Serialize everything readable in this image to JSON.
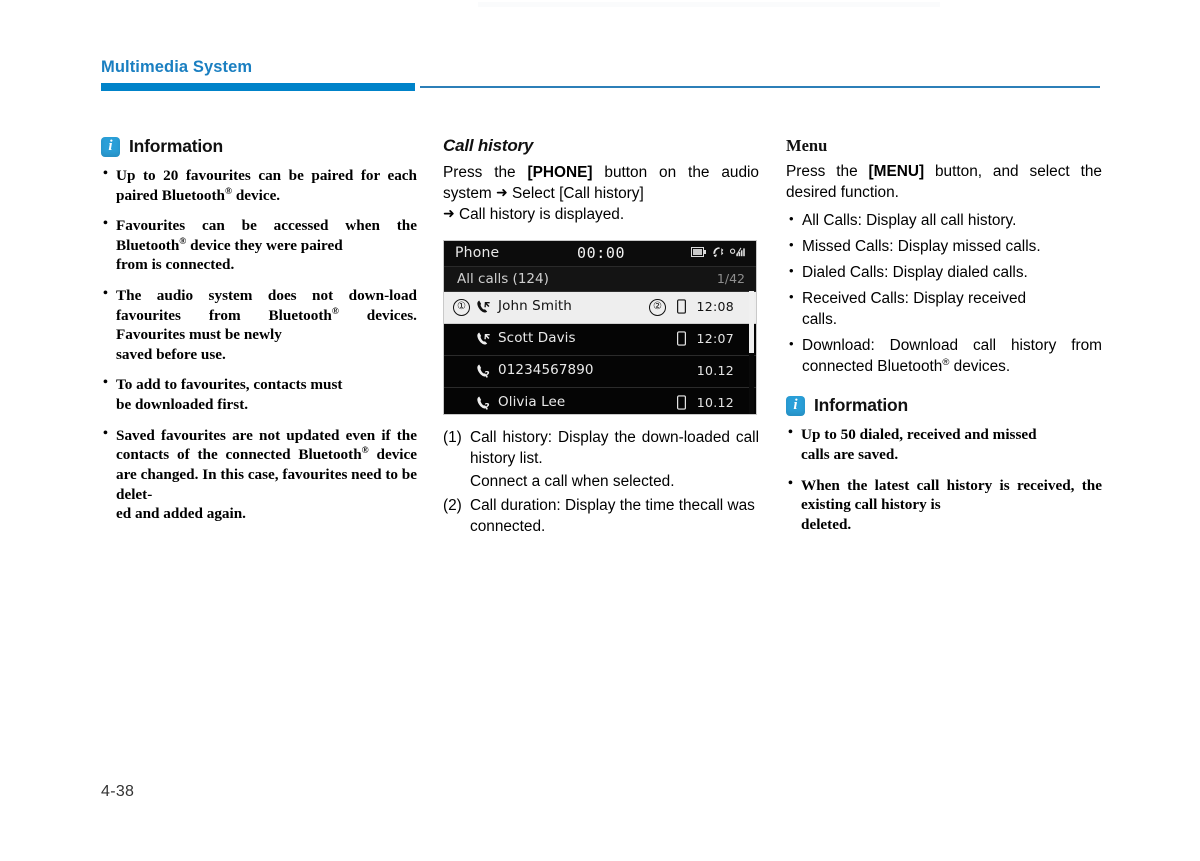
{
  "header": {
    "title": "Multimedia System",
    "accent_color": "#0083c9",
    "rule_color": "#2c7fb8"
  },
  "footer": {
    "page_number": "4-38"
  },
  "left_column": {
    "info": {
      "icon": "info-i-icon",
      "badge_color": "#2a9fd8",
      "title": "Information",
      "bullets": [
        {
          "text": "Up to 20 favourites can be paired for each paired Bluetooth",
          "reg": "®",
          "tail": " device."
        },
        {
          "text": "Favourites can be accessed when the Bluetooth",
          "reg": "®",
          "tail": " device they were paired",
          "lastline": "from is connected."
        },
        {
          "text": "The audio system does not down-load favourites from Bluetooth",
          "reg": "®",
          "tail": " devices. Favourites  must be newly",
          "lastline": "saved before use."
        },
        {
          "text": "To add to favourites, contacts must",
          "lastline": "be downloaded first."
        },
        {
          "text": "Saved favourites are not updated even if the contacts of the connected Bluetooth",
          "reg": "®",
          "tail": " device are changed. In this case, favourites need to be delet-",
          "lastline": "ed and added again."
        }
      ]
    }
  },
  "mid_column": {
    "section_title": "Call history",
    "intro": {
      "p1_a": "Press the ",
      "p1_b": "[PHONE]",
      "p1_c": " button on the audio system ",
      "arrow1": "➜",
      "p1_d": " Select [Call history]",
      "p2_arrow": "➜",
      "p2": " Call history is displayed."
    },
    "device": {
      "status_bar": {
        "title": "Phone",
        "clock": "00:00",
        "icons": [
          "battery-icon",
          "bluetooth-phone-icon",
          "signal-roaming-icon"
        ]
      },
      "sub_bar": {
        "label": "All calls (124)",
        "page": "1/42"
      },
      "rows": [
        {
          "callout": "①",
          "call_icon": "call-received-icon",
          "name": "John Smith",
          "callout2": "②",
          "device_icon": "mobile-phone-icon",
          "time": "12:08",
          "selected": true
        },
        {
          "call_icon": "call-received-icon",
          "name": "Scott Davis",
          "device_icon": "mobile-phone-icon",
          "time": "12:07",
          "selected": false
        },
        {
          "call_icon": "call-missed-icon",
          "name": "01234567890",
          "device_icon": "",
          "time": "10.12",
          "selected": false
        },
        {
          "call_icon": "call-missed-icon",
          "name": "Olivia Lee",
          "device_icon": "mobile-phone-icon",
          "time": "10.12",
          "selected": false
        }
      ]
    },
    "captions": [
      {
        "num": "(1)",
        "text": "Call history: Display the down-loaded call history list.",
        "lastline": "loaded call history list.",
        "first": "Call history: Display the down-"
      },
      {
        "sub": "Connect a call when selected."
      },
      {
        "num": "(2)",
        "first": "Call duration: Display the time the",
        "lastline": "call was connected."
      }
    ],
    "caption_1_num": "(1)",
    "caption_1_line1": "Call history: Display the down-",
    "caption_1_line2": "loaded call history list.",
    "caption_1_sub": "Connect a call when selected.",
    "caption_2_num": "(2)",
    "caption_2_line1": "Call duration: Display the time the",
    "caption_2_line2": "call was connected."
  },
  "right_column": {
    "menu": {
      "title": "Menu",
      "intro_a": "Press the ",
      "intro_b": "[MENU]",
      "intro_c": " button, and select the desired function.",
      "bullets": [
        {
          "text": "All Calls: Display all call history."
        },
        {
          "text": "Missed Calls: Display missed calls."
        },
        {
          "text": "Dialed Calls: Display dialed calls."
        },
        {
          "text": "Received Calls: Display received",
          "lastline": "calls."
        },
        {
          "text": "Download: Download call history from connected Bluetooth",
          "reg": "®",
          "tail": " devices."
        }
      ]
    },
    "info": {
      "icon": "info-i-icon",
      "title": "Information",
      "bullets": [
        {
          "text": "Up to 50 dialed, received and missed",
          "lastline": "calls are saved."
        },
        {
          "text": "When the latest call history is received, the existing call history is",
          "lastline": "deleted."
        }
      ]
    }
  }
}
